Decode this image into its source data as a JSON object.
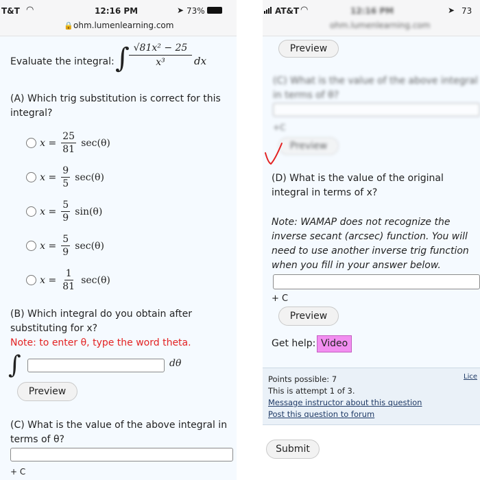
{
  "left": {
    "status": {
      "carrier": "T&T",
      "time": "12:16 PM",
      "battery": "73%",
      "url": "ohm.lumenlearning.com"
    },
    "integral": {
      "label": "Evaluate the integral:",
      "numerator": "√81x² − 25",
      "denominator": "x³",
      "dx": "dx"
    },
    "partA": {
      "question": "(A) Which trig substitution is correct for this integral?",
      "options": [
        {
          "lhs": "x =",
          "num": "25",
          "den": "81",
          "func": "sec(θ)"
        },
        {
          "lhs": "x =",
          "num": "9",
          "den": "5",
          "func": "sec(θ)"
        },
        {
          "lhs": "x =",
          "num": "5",
          "den": "9",
          "func": "sin(θ)"
        },
        {
          "lhs": "x =",
          "num": "5",
          "den": "9",
          "func": "sec(θ)"
        },
        {
          "lhs": "x =",
          "num": "1",
          "den": "81",
          "func": "sec(θ)"
        }
      ]
    },
    "partB": {
      "question": "(B) Which integral do you obtain after substituting for x?",
      "note": "Note: to enter θ, type the word theta.",
      "dtheta": "dθ",
      "preview": "Preview"
    },
    "partC": {
      "question": "(C) What is the value of the above integral in terms of θ?",
      "plus_c": "+ C"
    }
  },
  "right": {
    "status": {
      "carrier": "AT&T",
      "time": "12:16 PM",
      "battery": "73",
      "url": "ohm.lumenlearning.com"
    },
    "blurred": {
      "preview1": "Preview",
      "question_c": "(C) What is the value of the above integral in terms of θ?",
      "plus_c": "+C",
      "preview2": "Preview"
    },
    "partD": {
      "question": "(D) What is the value of the original integral in terms of x?",
      "note": "Note: WAMAP does not recognize the inverse secant (arcsec) function. You will need to use another inverse trig function when you fill in your answer below.",
      "plus_c": "+ C",
      "preview": "Preview",
      "help_label": "Get help:",
      "video": "Video"
    },
    "footer": {
      "points": "Points possible: 7",
      "attempt": "This is attempt 1 of 3.",
      "message": "Message instructor about this question",
      "post": "Post this question to forum",
      "license": "Lice"
    },
    "submit": "Submit"
  },
  "colors": {
    "red": "#e32222",
    "video_bg": "#f28ef0",
    "panel_bg": "#f5faff",
    "footer_bg": "#eaf1f8"
  }
}
